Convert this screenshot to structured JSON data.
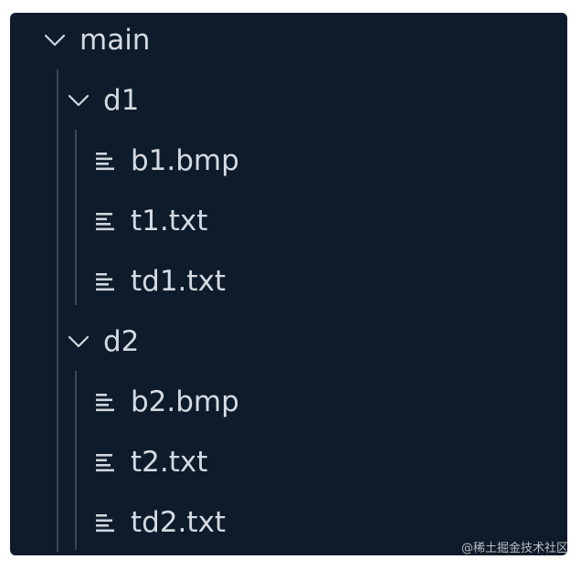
{
  "tree": {
    "root": {
      "label": "main",
      "expanded": true,
      "children": [
        {
          "label": "d1",
          "expanded": true,
          "files": [
            "b1.bmp",
            "t1.txt",
            "td1.txt"
          ]
        },
        {
          "label": "d2",
          "expanded": true,
          "files": [
            "b2.bmp",
            "t2.txt",
            "td2.txt"
          ]
        }
      ]
    }
  },
  "icons": {
    "expanded_folder": "chevron-down-icon",
    "file": "file-lines-icon"
  },
  "colors": {
    "panel_background": "#0e1b2a",
    "text": "#d4dae2",
    "icon": "#cfd6de",
    "indent_guide": "#3a4757"
  },
  "watermark": "@稀土掘金技术社区"
}
